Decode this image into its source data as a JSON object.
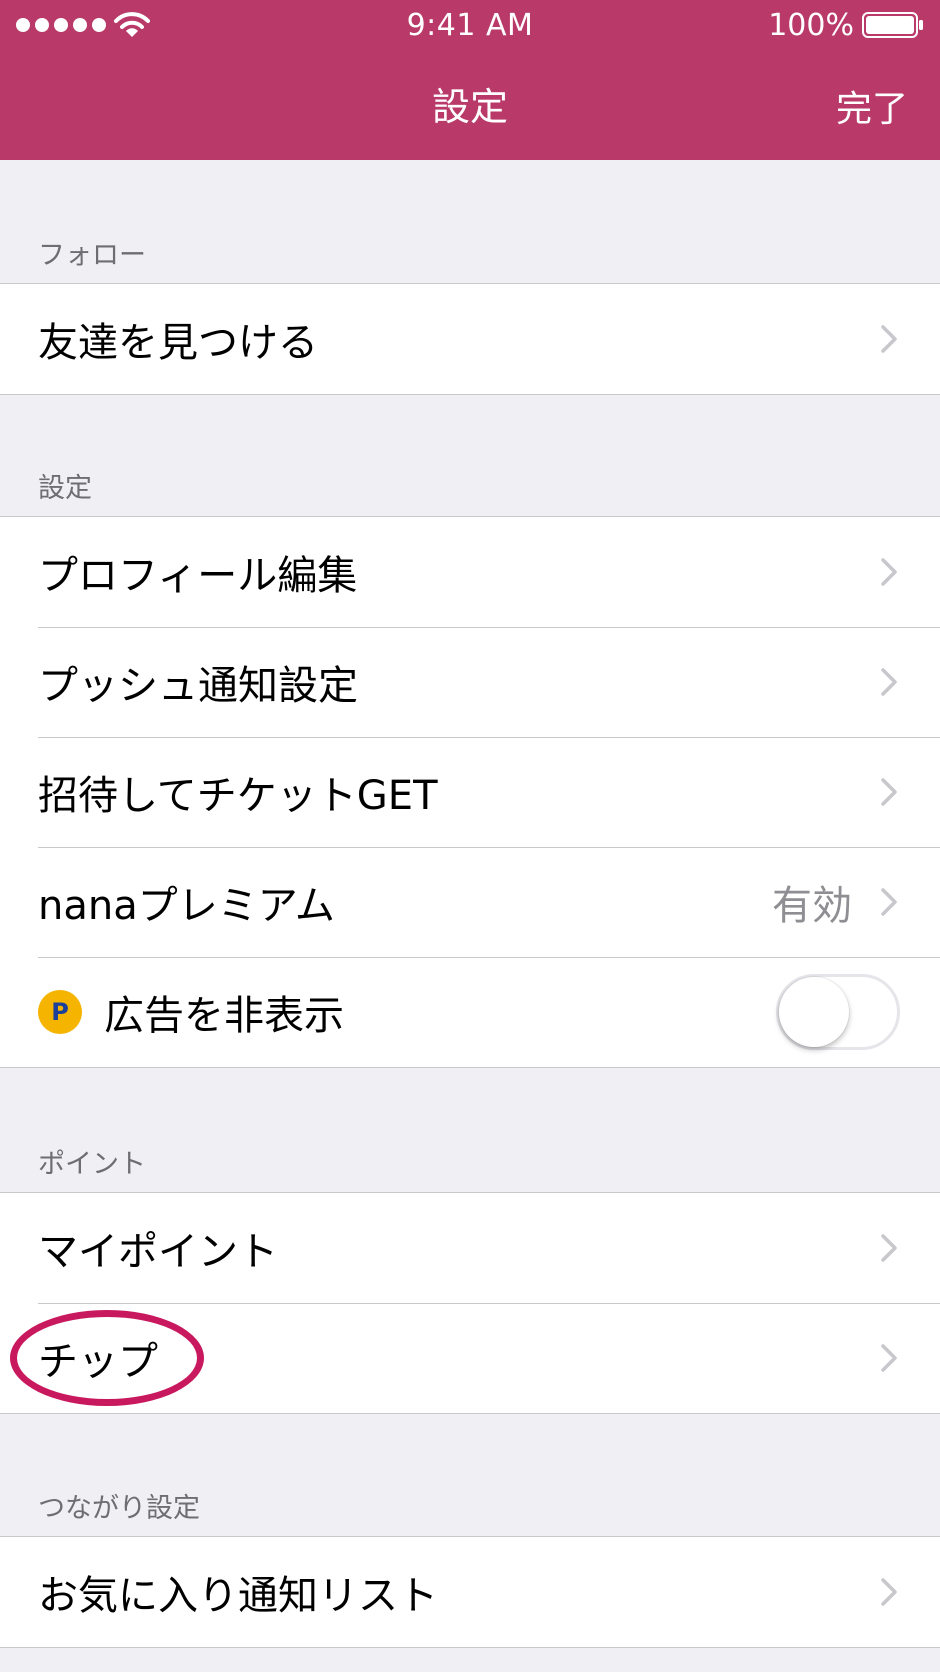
{
  "status_bar": {
    "time": "9:41 AM",
    "battery_percent": "100%",
    "signal_icon": "signal-dots-icon",
    "wifi_icon": "wifi-icon",
    "battery_icon": "battery-icon"
  },
  "nav": {
    "title": "設定",
    "done_label": "完了"
  },
  "colors": {
    "brand": "#b93a68",
    "highlight": "#c9195e",
    "point_badge": "#f5b400"
  },
  "sections": [
    {
      "header": "フォロー",
      "items": [
        {
          "label": "友達を見つける",
          "accessory": "chevron-right-icon"
        }
      ]
    },
    {
      "header": "設定",
      "items": [
        {
          "label": "プロフィール編集",
          "accessory": "chevron-right-icon"
        },
        {
          "label": "プッシュ通知設定",
          "accessory": "chevron-right-icon"
        },
        {
          "label": "招待してチケットGET",
          "accessory": "chevron-right-icon"
        },
        {
          "label": "nanaプレミアム",
          "detail": "有効",
          "accessory": "chevron-right-icon"
        },
        {
          "label": "広告を非表示",
          "badge": "P",
          "badge_icon": "point-coin-icon",
          "toggle_on": false
        }
      ]
    },
    {
      "header": "ポイント",
      "items": [
        {
          "label": "マイポイント",
          "accessory": "chevron-right-icon"
        },
        {
          "label": "チップ",
          "accessory": "chevron-right-icon",
          "highlighted": true
        }
      ]
    },
    {
      "header": "つながり設定",
      "items": [
        {
          "label": "お気に入り通知リスト",
          "accessory": "chevron-right-icon"
        }
      ]
    }
  ]
}
